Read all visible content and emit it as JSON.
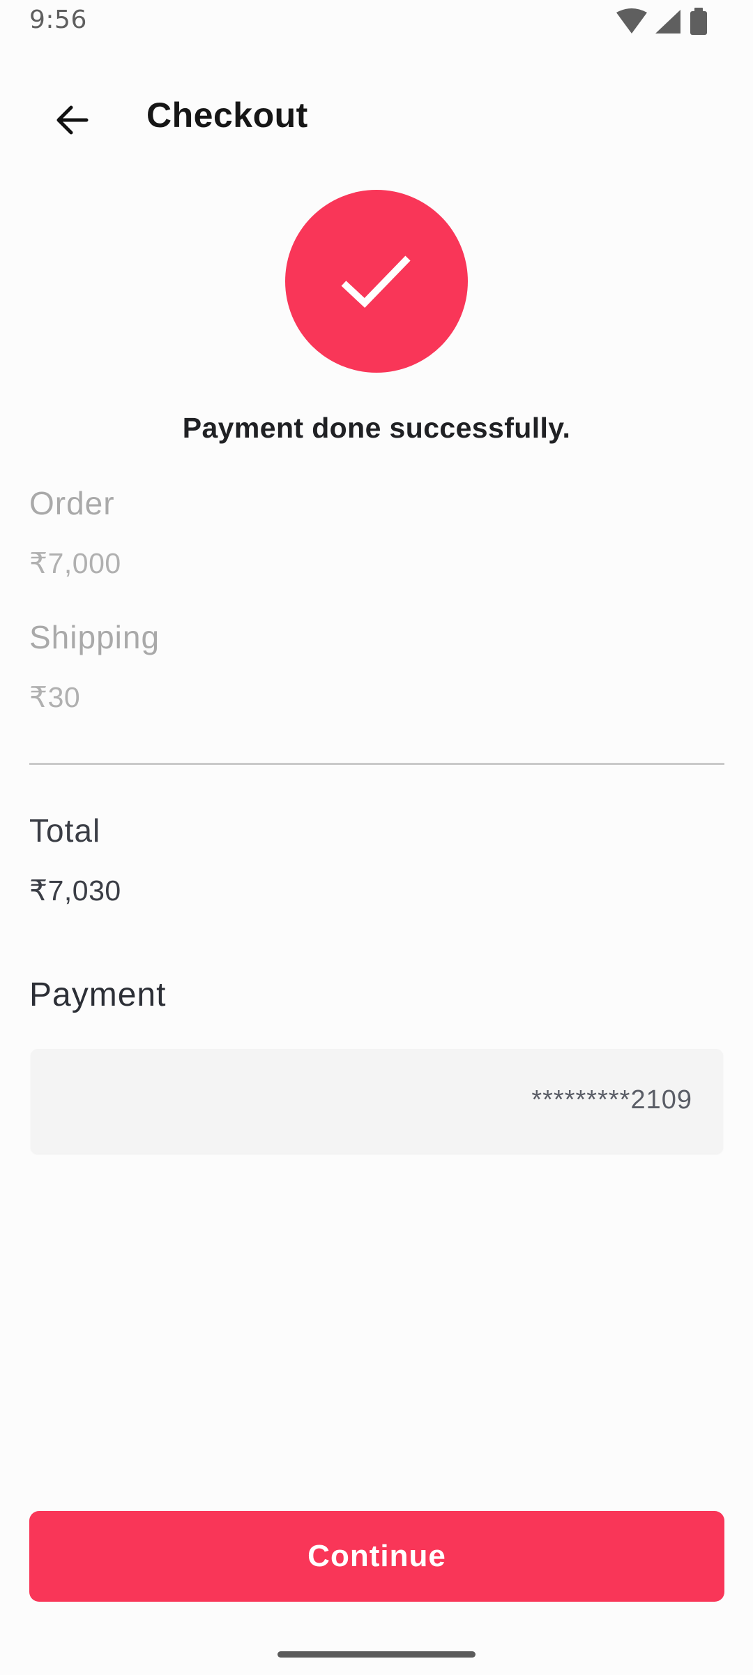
{
  "status_bar": {
    "time": "9:56",
    "icons": [
      "wifi-icon",
      "signal-icon",
      "battery-icon"
    ]
  },
  "app_bar": {
    "back_icon": "arrow-left-icon",
    "title": "Checkout"
  },
  "success": {
    "icon": "checkmark-icon",
    "message": "Payment done successfully."
  },
  "summary": {
    "order_label": "Order",
    "order_value": "₹7,000",
    "shipping_label": "Shipping",
    "shipping_value": "₹30",
    "total_label": "Total",
    "total_value": "₹7,030"
  },
  "payment": {
    "label": "Payment",
    "card_masked": "*********2109"
  },
  "actions": {
    "continue_label": "Continue"
  },
  "colors": {
    "accent": "#f93658",
    "background": "#fcfcfc",
    "muted_text": "#a9a9a9",
    "strong_text": "#3a3d45",
    "card_bg": "#f4f4f4"
  }
}
